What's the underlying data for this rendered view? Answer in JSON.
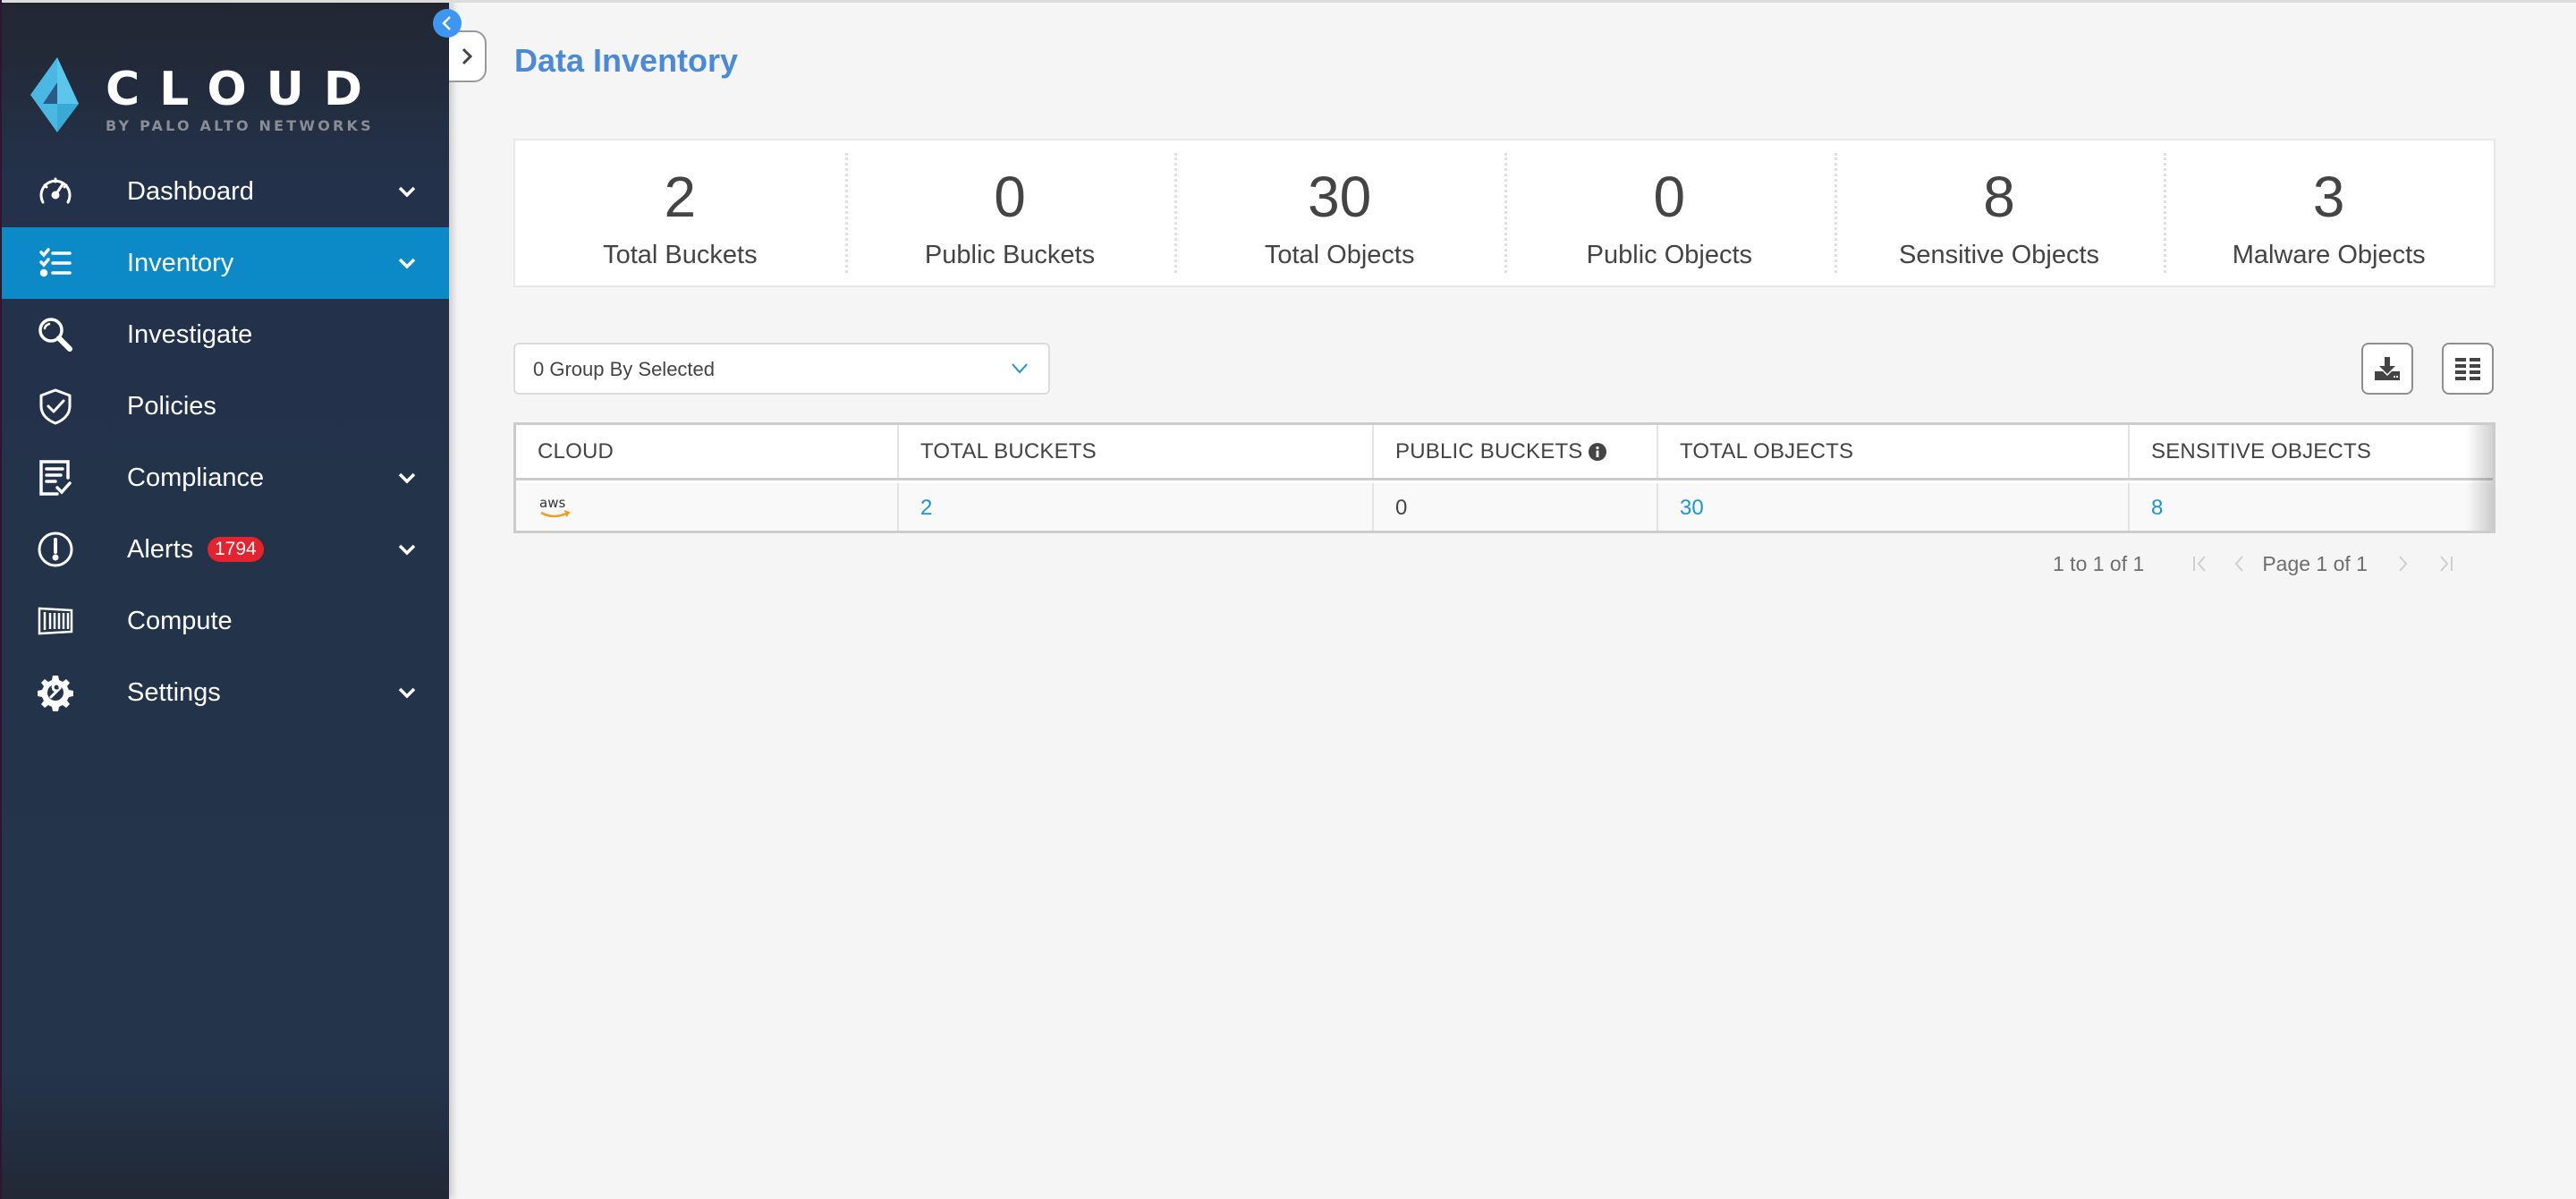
{
  "app": {
    "logo_word": "CLOUD",
    "logo_sub": "BY PALO ALTO NETWORKS"
  },
  "sidebar": {
    "items": [
      {
        "label": "Dashboard",
        "icon": "dashboard-gauge-icon",
        "has_chevron": true,
        "active": false
      },
      {
        "label": "Inventory",
        "icon": "checklist-icon",
        "has_chevron": true,
        "active": true
      },
      {
        "label": "Investigate",
        "icon": "search-icon",
        "has_chevron": false,
        "active": false
      },
      {
        "label": "Policies",
        "icon": "shield-check-icon",
        "has_chevron": false,
        "active": false
      },
      {
        "label": "Compliance",
        "icon": "compliance-doc-icon",
        "has_chevron": true,
        "active": false
      },
      {
        "label": "Alerts",
        "icon": "alert-circle-icon",
        "has_chevron": true,
        "active": false,
        "badge": "1794"
      },
      {
        "label": "Compute",
        "icon": "container-icon",
        "has_chevron": false,
        "active": false
      },
      {
        "label": "Settings",
        "icon": "settings-gear-icon",
        "has_chevron": true,
        "active": false
      }
    ]
  },
  "page": {
    "title": "Data Inventory"
  },
  "stats": [
    {
      "value": "2",
      "label": "Total Buckets"
    },
    {
      "value": "0",
      "label": "Public Buckets"
    },
    {
      "value": "30",
      "label": "Total Objects"
    },
    {
      "value": "0",
      "label": "Public Objects"
    },
    {
      "value": "8",
      "label": "Sensitive Objects"
    },
    {
      "value": "3",
      "label": "Malware Objects"
    }
  ],
  "toolbar": {
    "group_by_text": "0 Group By Selected",
    "download_icon": "download-icon",
    "columns_icon": "columns-icon"
  },
  "table": {
    "columns": [
      "CLOUD",
      "TOTAL BUCKETS",
      "PUBLIC BUCKETS",
      "TOTAL OBJECTS",
      "SENSITIVE OBJECTS"
    ],
    "rows": [
      {
        "cloud": "aws",
        "total_buckets": "2",
        "public_buckets": "0",
        "total_objects": "30",
        "sensitive_objects": "8"
      }
    ]
  },
  "pagination": {
    "count_text": "1 to 1 of 1",
    "page_text": "Page 1 of 1"
  },
  "colors": {
    "accent": "#0b8ac7",
    "title": "#4a8ad8",
    "link": "#1a96d6",
    "badge": "#e3232e",
    "sidebar": "#23344b"
  }
}
